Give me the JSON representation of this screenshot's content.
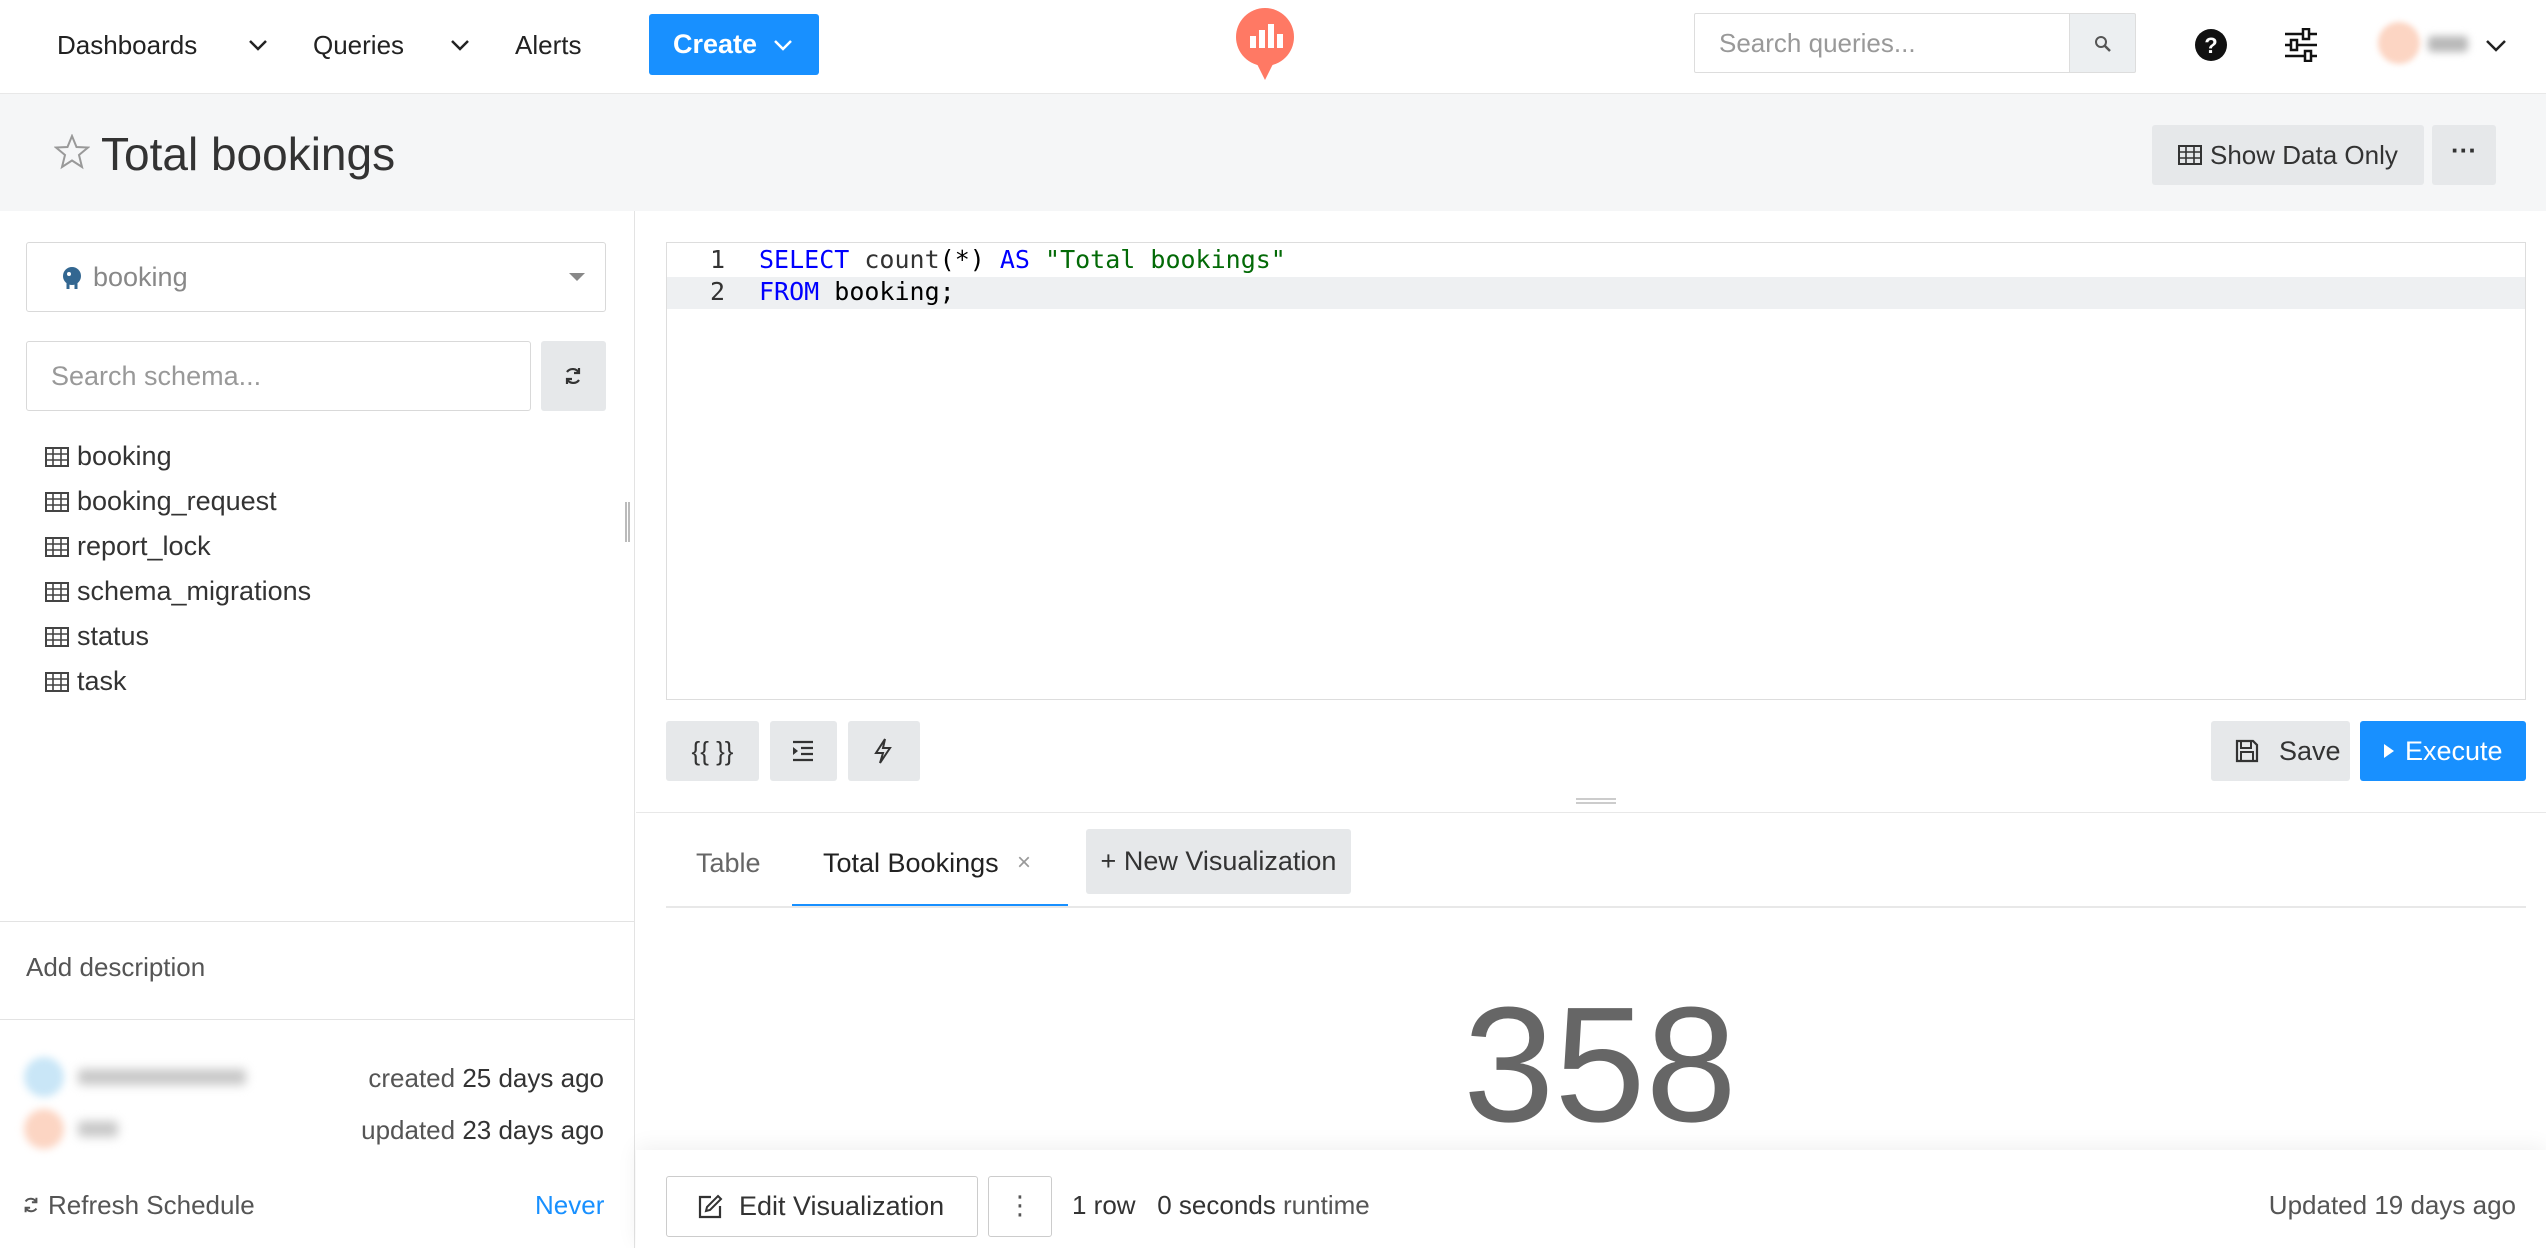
{
  "nav": {
    "dashboards": "Dashboards",
    "queries": "Queries",
    "alerts": "Alerts",
    "create": "Create",
    "search_placeholder": "Search queries...",
    "brand_color": "#ff7964",
    "accent": "#1890ff"
  },
  "header": {
    "title": "Total bookings",
    "show_data_only": "Show Data Only",
    "more": "···"
  },
  "sidebar": {
    "datasource": "booking",
    "schema_placeholder": "Search schema...",
    "tables": [
      "booking",
      "booking_request",
      "report_lock",
      "schema_migrations",
      "status",
      "task"
    ],
    "add_description": "Add description",
    "created_prefix": "created",
    "created_when": "25 days ago",
    "updated_prefix": "updated",
    "updated_when": "23 days ago",
    "refresh_label": "Refresh Schedule",
    "refresh_value": "Never"
  },
  "editor": {
    "line_numbers": [
      "1",
      "2"
    ],
    "line1": {
      "kw1": "SELECT",
      "fn": "count",
      "args": "(*)",
      "kw2": "AS",
      "str": "\"Total bookings\""
    },
    "line2": {
      "kw": "FROM",
      "rest": "booking;"
    }
  },
  "toolbar": {
    "params_label": "{{ }}",
    "save_label": "Save",
    "execute_label": "Execute"
  },
  "results": {
    "tabs": [
      "Table",
      "Total Bookings"
    ],
    "active_tab": "Total Bookings",
    "close": "×",
    "new_visualization": "+ New Visualization",
    "counter_value": "358",
    "edit_visualization": "Edit Visualization",
    "kebab": "⋮",
    "rows": "1 row",
    "runtime_value": "0 seconds",
    "runtime_suffix": "runtime",
    "updated": "Updated 19 days ago"
  }
}
